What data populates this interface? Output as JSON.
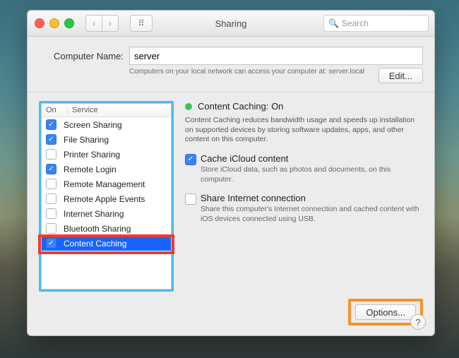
{
  "window": {
    "title": "Sharing"
  },
  "search": {
    "placeholder": "Search"
  },
  "computer_name": {
    "label": "Computer Name:",
    "value": "server",
    "help": "Computers on your local network can access your computer at: server.local",
    "edit_label": "Edit..."
  },
  "service_table": {
    "headers": {
      "on": "On",
      "service": "Service"
    },
    "rows": [
      {
        "label": "Screen Sharing",
        "checked": true,
        "selected": false
      },
      {
        "label": "File Sharing",
        "checked": true,
        "selected": false
      },
      {
        "label": "Printer Sharing",
        "checked": false,
        "selected": false
      },
      {
        "label": "Remote Login",
        "checked": true,
        "selected": false
      },
      {
        "label": "Remote Management",
        "checked": false,
        "selected": false
      },
      {
        "label": "Remote Apple Events",
        "checked": false,
        "selected": false
      },
      {
        "label": "Internet Sharing",
        "checked": false,
        "selected": false
      },
      {
        "label": "Bluetooth Sharing",
        "checked": false,
        "selected": false
      },
      {
        "label": "Content Caching",
        "checked": true,
        "selected": true
      }
    ]
  },
  "detail": {
    "status": "Content Caching: On",
    "description": "Content Caching reduces bandwidth usage and speeds up installation on supported devices by storing software updates, apps, and other content on this computer.",
    "opt1": {
      "title": "Cache iCloud content",
      "desc": "Store iCloud data, such as photos and documents, on this computer.",
      "checked": true
    },
    "opt2": {
      "title": "Share Internet connection",
      "desc": "Share this computer's Internet connection and cached content with iOS devices connected using USB.",
      "checked": false
    },
    "options_label": "Options..."
  },
  "help_glyph": "?"
}
